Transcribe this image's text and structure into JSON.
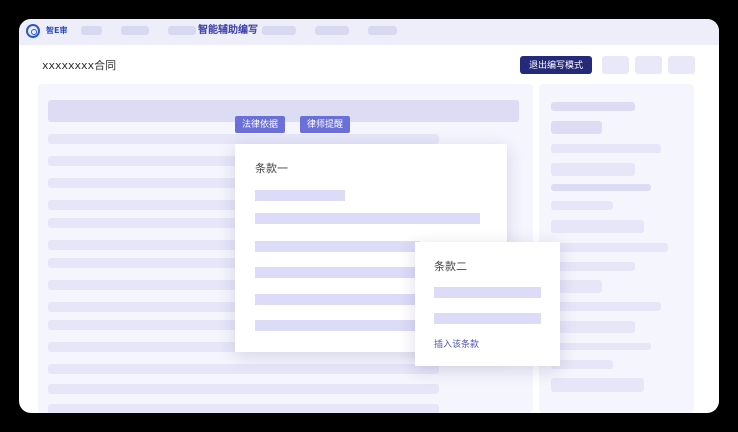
{
  "brand": "智E审",
  "nav": {
    "active_label": "智能辅助编写"
  },
  "header": {
    "document_title": "xxxxxxxx合同",
    "exit_button": "退出编写模式"
  },
  "tags": {
    "legal_basis": "法律依据",
    "lawyer_tips": "律师提醒"
  },
  "clause_one": {
    "title": "条款一"
  },
  "clause_two": {
    "title": "条款二",
    "insert_action": "插入该条款"
  }
}
